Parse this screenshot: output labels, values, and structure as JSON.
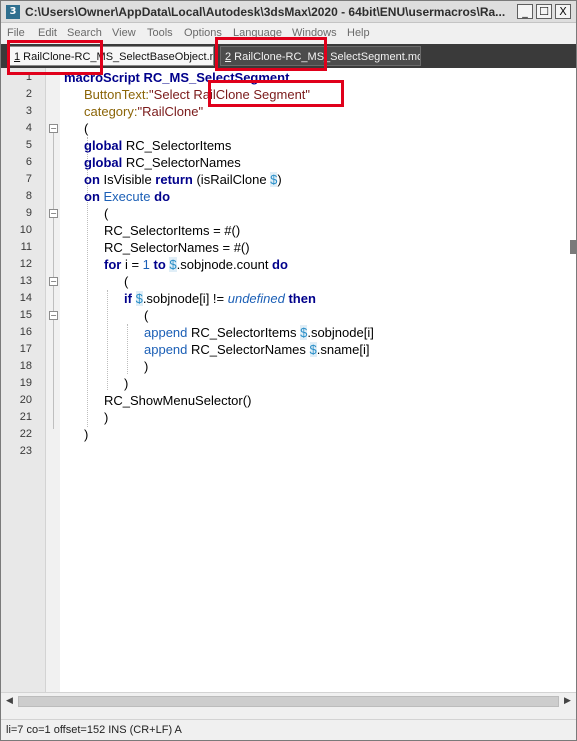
{
  "window": {
    "icon_label": "3",
    "title": "C:\\Users\\Owner\\AppData\\Local\\Autodesk\\3dsMax\\2020 - 64bit\\ENU\\usermacros\\Ra...",
    "minimize_label": "_",
    "maximize_label": "☐",
    "close_label": "X"
  },
  "menu": {
    "items": [
      "File",
      "Edit",
      "Search",
      "View",
      "Tools",
      "Options",
      "Language",
      "Windows",
      "Help"
    ]
  },
  "tabs": [
    {
      "number": "1",
      "label": " RailClone-RC_MS_SelectBaseObject.mcr"
    },
    {
      "number": "2",
      "label": " RailClone-RC_MS_SelectSegment.mcr"
    }
  ],
  "editor": {
    "line_numbers": [
      "1",
      "2",
      "3",
      "4",
      "5",
      "6",
      "7",
      "8",
      "9",
      "10",
      "11",
      "12",
      "13",
      "14",
      "15",
      "16",
      "17",
      "18",
      "19",
      "20",
      "21",
      "22",
      "23"
    ],
    "fold_markers": {
      "4": "−",
      "9": "−",
      "13": "−",
      "15": "−"
    },
    "lines": {
      "l1_kw": "macroScript",
      "l1_rest": " RC_MS_SelectSegment",
      "l2_prop": "ButtonText:",
      "l2_str": "\"Select RailClone Segment\"",
      "l3_prop": "category:",
      "l3_str": "\"RailClone\"",
      "l4": "(",
      "l5_kw": "global",
      "l5_rest": " RC_SelectorItems",
      "l6_kw": "global",
      "l6_rest": " RC_SelectorNames",
      "l7_kw1": "on",
      "l7_mid": " IsVisible ",
      "l7_kw2": "return",
      "l7_rest": " (isRailClone ",
      "l7_dollar": "$",
      "l7_end": ")",
      "l8_kw1": "on",
      "l8_mid": "Execute",
      "l8_kw2": "do",
      "l9": "(",
      "l10_a": "RC_SelectorItems = ",
      "l10_b": "#()",
      "l11_a": "RC_SelectorNames = ",
      "l11_b": "#()",
      "l12_kw1": "for",
      "l12_a": " i = ",
      "l12_num": "1",
      "l12_kw2": " to ",
      "l12_dollar": "$",
      "l12_b": ".sobjnode.count ",
      "l12_kw3": "do",
      "l13": "(",
      "l14_kw1": "if",
      "l14_dollar": "$",
      "l14_a": ".sobjnode[i] != ",
      "l14_undef": "undefined",
      "l14_kw2": " then",
      "l15": "(",
      "l16_fn": "append",
      "l16_a": " RC_SelectorItems ",
      "l16_dollar": "$",
      "l16_b": ".sobjnode[i]",
      "l17_fn": "append",
      "l17_a": " RC_SelectorNames ",
      "l17_dollar": "$",
      "l17_b": ".sname[i]",
      "l18": ")",
      "l19": ")",
      "l20": "RC_ShowMenuSelector()",
      "l21": ")",
      "l22": ")"
    }
  },
  "scrollbar": {
    "left_arrow": "◀",
    "right_arrow": "▶"
  },
  "status": {
    "text": "li=7 co=1 offset=152 INS (CR+LF) A"
  },
  "colors": {
    "highlight": "#e0001b",
    "keyword": "#00008b",
    "string": "#7a1a1a",
    "property": "#8b6508"
  }
}
